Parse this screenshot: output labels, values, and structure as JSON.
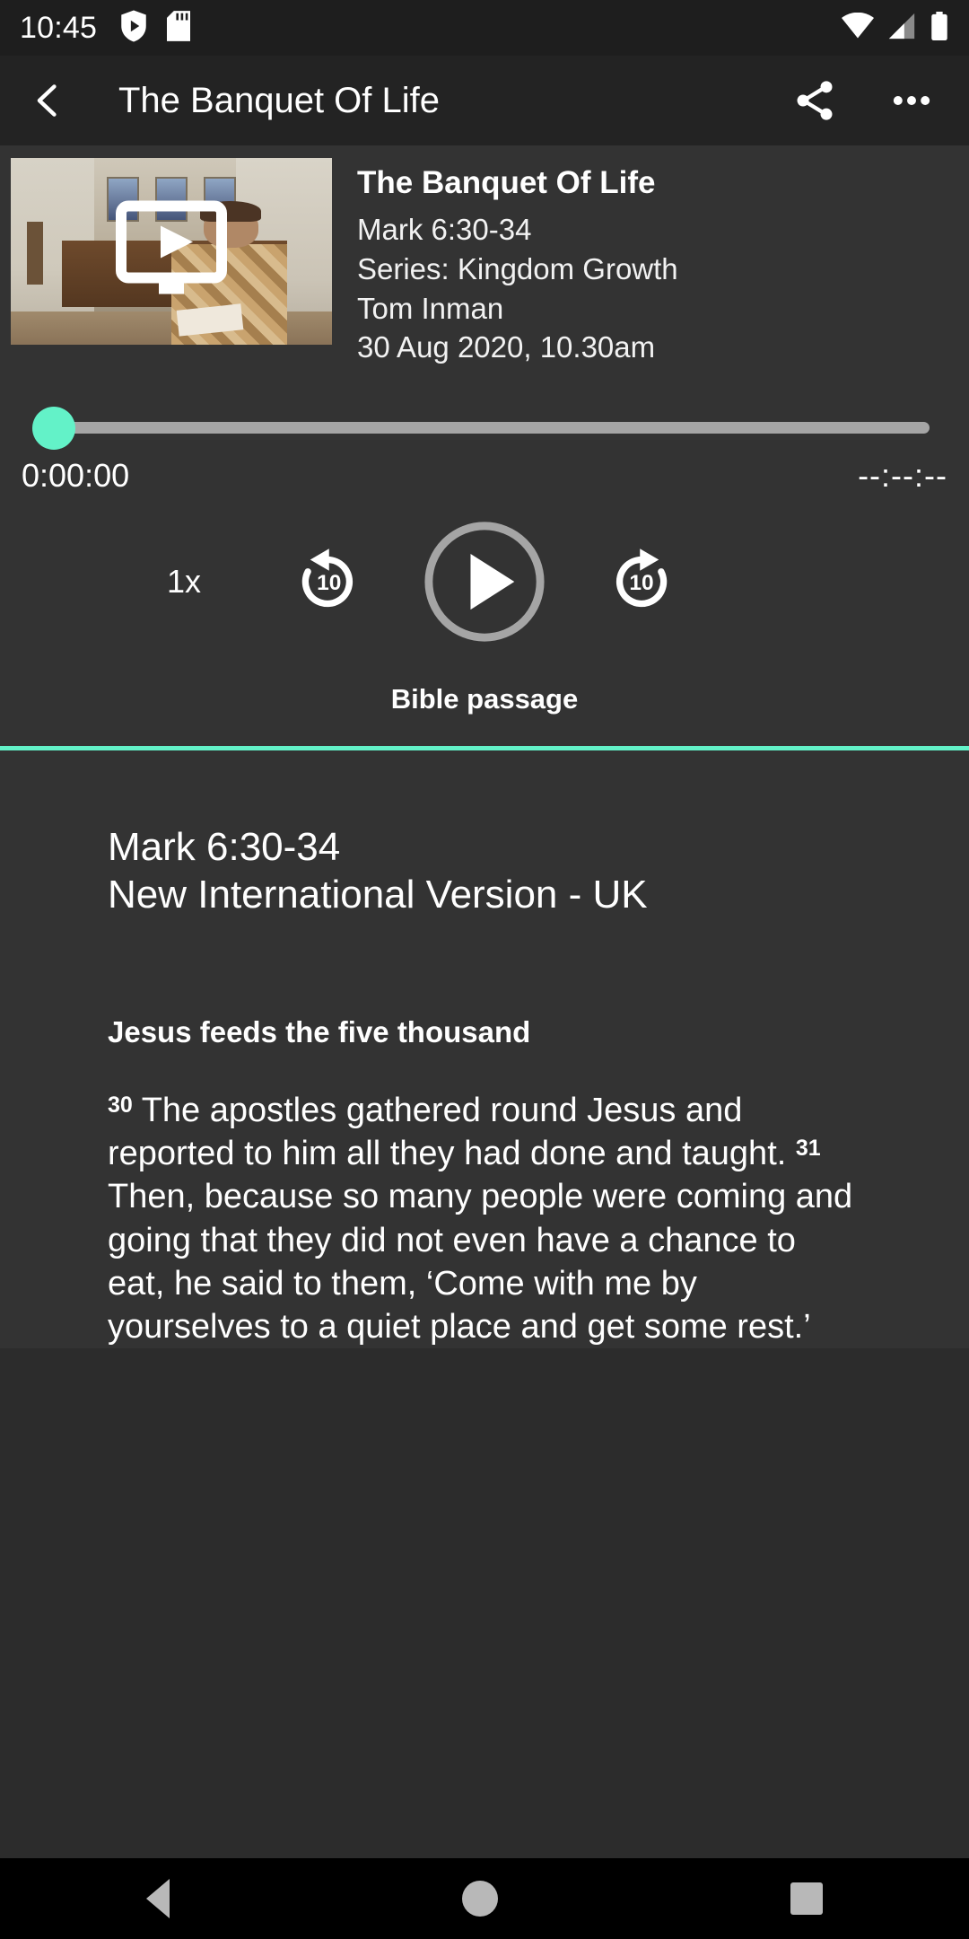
{
  "status_bar": {
    "clock": "10:45",
    "left_icons": [
      "play-protect-shield-icon",
      "sd-card-icon"
    ],
    "right_icons": [
      "wifi-icon",
      "cellular-signal-icon",
      "battery-full-icon"
    ]
  },
  "app_bar": {
    "back_label": "back-arrow",
    "title": "The Banquet Of Life",
    "share_label": "share-icon",
    "overflow_label": "more-options-icon"
  },
  "player": {
    "thumbnail_alt": "sermon-video-thumbnail",
    "play_overlay": "play-video-overlay-icon",
    "title": "The Banquet Of Life",
    "reference": "Mark 6:30-34",
    "series": "Series: Kingdom Growth",
    "speaker": "Tom Inman",
    "datetime": "30 Aug 2020, 10.30am",
    "progress_percent": 0,
    "current_time": "0:00:00",
    "duration": "--:--:--",
    "speed": "1x",
    "rewind_seconds": "10",
    "forward_seconds": "10",
    "play_state": "paused",
    "section_label": "Bible passage",
    "accent_color": "#63f2c8",
    "track_color": "#a5a5a5"
  },
  "passage": {
    "reference_line1": "Mark 6:30-34",
    "reference_line2": "New International Version - UK",
    "heading": "Jesus feeds the five thousand",
    "verse_30_number": "30",
    "verse_30_text": "The apostles gathered round Jesus and reported to him all they had done and taught.",
    "verse_31_number": "31",
    "verse_31_text": "Then, because so many people were coming and going that they did not even have a chance to eat, he said to them, ‘Come with me by yourselves to a quiet place and get some rest.’"
  },
  "nav_bar": {
    "back": "nav-back-icon",
    "home": "nav-home-icon",
    "recents": "nav-recents-icon"
  }
}
